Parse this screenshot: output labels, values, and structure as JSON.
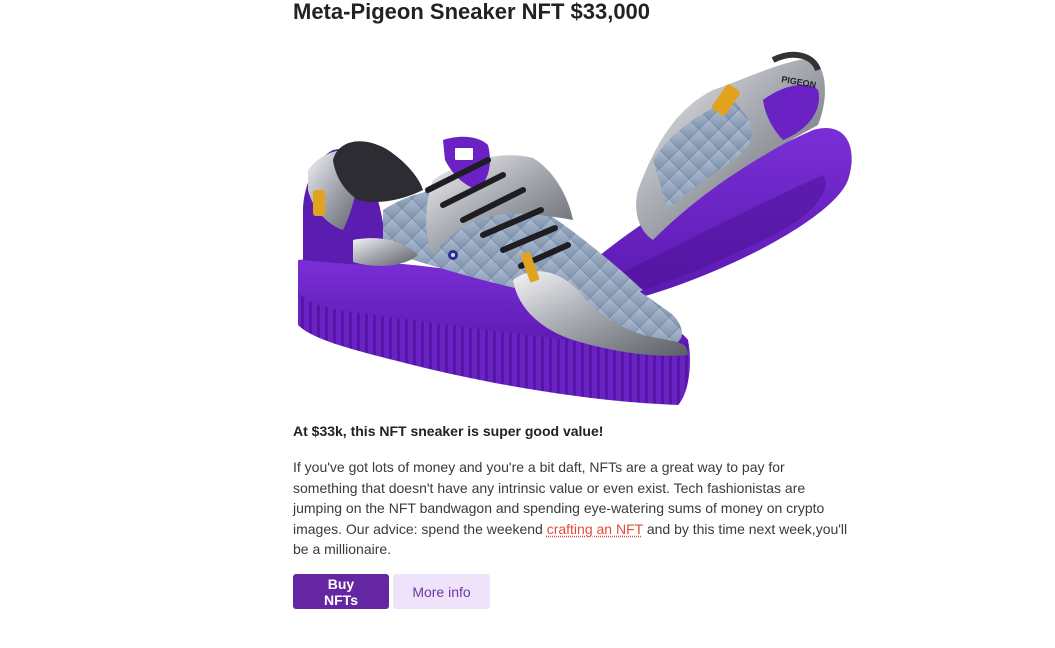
{
  "article": {
    "title": "Meta-Pigeon Sneaker NFT $33,000",
    "lead": "At $33k, this NFT sneaker is super good value!",
    "body_before_link": "If you've got lots of money and you're a bit daft, NFTs are a great way to pay for something that doesn't have any intrinsic value or even exist. Tech fashionistas are jumping on the NFT bandwagon and spending eye-watering sums of money on crypto images. Our advice: spend the weekend ",
    "body_link_text": "crafting an NFT",
    "body_after_link": " and by this time next week,you'll be a millionaire.",
    "image": {
      "subject": "pair of purple and silver futuristic sneakers",
      "shoe_label": "PIGEON"
    }
  },
  "actions": {
    "primary_label": "Buy NFTs",
    "secondary_label": "More info"
  },
  "colors": {
    "accent_purple": "#6526a3",
    "secondary_bg": "#efe2fb",
    "link": "#e04b3a",
    "sole_purple": "#6a22c4"
  }
}
